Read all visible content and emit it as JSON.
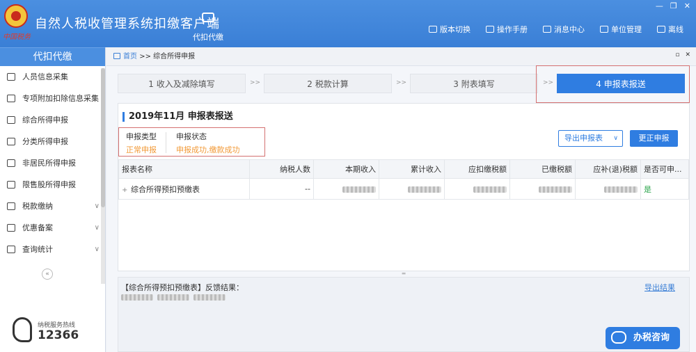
{
  "app": {
    "logo_text": "中国税务",
    "title": "自然人税收管理系统扣缴客户端",
    "module_label": "代扣代缴"
  },
  "toolbar": {
    "version_switch": "版本切换",
    "manual": "操作手册",
    "messages": "消息中心",
    "unit_management": "单位管理",
    "offline": "离线"
  },
  "sidebar": {
    "header": "代扣代缴",
    "items": [
      {
        "label": "人员信息采集",
        "icon": "person-icon",
        "expand": ""
      },
      {
        "label": "专项附加扣除信息采集",
        "icon": "list-icon",
        "expand": ""
      },
      {
        "label": "综合所得申报",
        "icon": "layers-icon",
        "expand": ""
      },
      {
        "label": "分类所得申报",
        "icon": "pie-icon",
        "expand": ""
      },
      {
        "label": "非居民所得申报",
        "icon": "person-icon",
        "expand": ""
      },
      {
        "label": "限售股所得申报",
        "icon": "bar-chart-icon",
        "expand": ""
      },
      {
        "label": "税款缴纳",
        "icon": "folder-icon",
        "expand": "∨"
      },
      {
        "label": "优惠备案",
        "icon": "document-icon",
        "expand": "∨"
      },
      {
        "label": "查询统计",
        "icon": "search-list-icon",
        "expand": "∨"
      }
    ],
    "collapse": "«",
    "hotline_label": "纳税服务热线",
    "hotline_number": "12366"
  },
  "breadcrumb": {
    "home": "首页",
    "separator": ">>",
    "current": "综合所得申报"
  },
  "steps": [
    {
      "label": "1 收入及减除填写"
    },
    {
      "label": "2 税款计算"
    },
    {
      "label": "3 附表填写"
    },
    {
      "label": "4 申报表报送"
    }
  ],
  "step_separator": ">>",
  "section": {
    "title": "2019年11月  申报表报送",
    "declare_type_label": "申报类型",
    "declare_type_value": "正常申报",
    "declare_status_label": "申报状态",
    "declare_status_value": "申报成功,缴款成功",
    "export_button": "导出申报表",
    "correct_button": "更正申报"
  },
  "table": {
    "headers": [
      "报表名称",
      "纳税人数",
      "本期收入",
      "累计收入",
      "应扣缴税额",
      "已缴税额",
      "应补(退)税额",
      "是否可申..."
    ],
    "rows": [
      {
        "name": "综合所得预扣预缴表",
        "taxpayers": "--",
        "can_declare": "是"
      }
    ]
  },
  "feedback": {
    "title": "【综合所得预扣预缴表】反馈结果：",
    "export_link": "导出结果"
  },
  "consult_button": "办税咨询",
  "colors": {
    "primary": "#2f7de1",
    "header_bg": "#4b8fe0",
    "warning_text": "#f29a38",
    "success_text": "#2aa44b",
    "highlight_border": "#d47070"
  }
}
